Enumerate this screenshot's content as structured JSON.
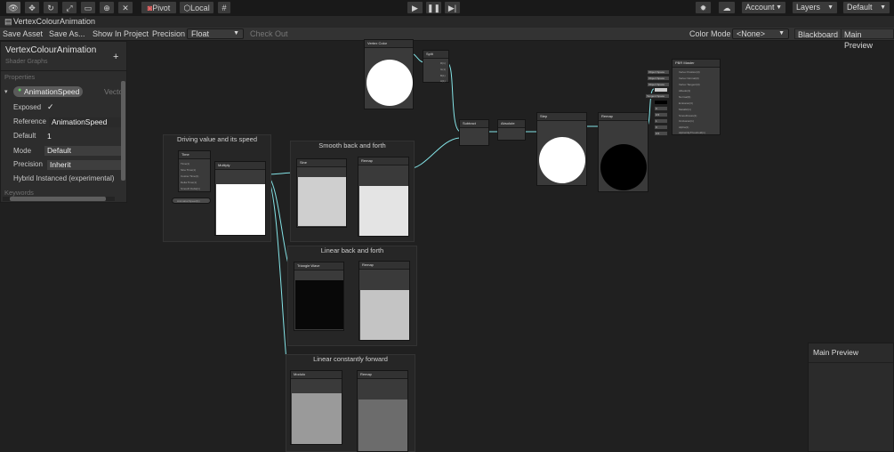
{
  "toolbar": {
    "pivot_label": "Pivot",
    "local_label": "Local",
    "account_label": "Account",
    "layers_label": "Layers",
    "layout_label": "Default"
  },
  "window": {
    "title": "VertexColourAnimation"
  },
  "graph_toolbar": {
    "save_asset": "Save Asset",
    "save_as": "Save As...",
    "show_in_project": "Show In Project",
    "precision_label": "Precision",
    "precision_value": "Float",
    "check_out": "Check Out",
    "color_mode_label": "Color Mode",
    "color_mode_value": "<None>",
    "blackboard": "Blackboard",
    "main_preview": "Main Preview"
  },
  "blackboard": {
    "title": "VertexColourAnimation",
    "subtitle": "Shader Graphs",
    "add": "+",
    "section": "Properties",
    "property_name": "AnimationSpeed",
    "property_type": "Vecto",
    "exposed_label": "Exposed",
    "exposed_check": "✓",
    "reference_label": "Reference",
    "reference_value": "AnimationSpeed",
    "default_label": "Default",
    "default_value": "1",
    "mode_label": "Mode",
    "mode_value": "Default",
    "precision_label": "Precision",
    "precision_value": "Inherit",
    "hybrid_label": "Hybrid Instanced (experimental)",
    "keywords_label": "Keywords"
  },
  "groups": {
    "g1": "Driving value and its speed",
    "g2": "Smooth back and forth",
    "g3": "Linear back and forth",
    "g4": "Linear constantly forward"
  },
  "nodes": {
    "vertex_color": "Vertex Color",
    "split": "Split",
    "time": "Time",
    "property": "AnimationSpeed(1)",
    "multiply": "Multiply",
    "sine": "Sine",
    "remap1": "Remap",
    "triangle": "Triangle Wave",
    "remap2": "Remap",
    "modulo": "Modulo",
    "remap3": "Remap",
    "subtract": "Subtract",
    "absolute": "Absolute",
    "step": "Step",
    "remap4": "Remap",
    "pbr": "PBR Master"
  },
  "ports": {
    "time_out": [
      "Time(1)",
      "Sine Time(1)",
      "Cosine Time(1)",
      "Delta Time(1)",
      "Smooth Delta(1)"
    ],
    "split_out": [
      "R(1)",
      "G(1)",
      "B(1)",
      "A(1)"
    ],
    "pbr_in": [
      "Vertex Position(3)",
      "Vertex Normal(3)",
      "Vertex Tangent(3)",
      "Albedo(3)",
      "Normal(3)",
      "Emission(3)",
      "Metallic(1)",
      "Smoothness(1)",
      "Occlusion(1)",
      "Alpha(1)",
      "AlphaClipThreshold(1)"
    ],
    "pbr_space": [
      "Object Space",
      "Object Space",
      "Object Space",
      "Tangent Space"
    ],
    "pbr_vals": [
      "0",
      "0.5",
      "1",
      "0",
      "0.5"
    ]
  },
  "main_preview": {
    "title": "Main Preview"
  },
  "colors": {
    "wire": "#84e4e7",
    "background": "#202020",
    "node": "#3a3a3a"
  }
}
